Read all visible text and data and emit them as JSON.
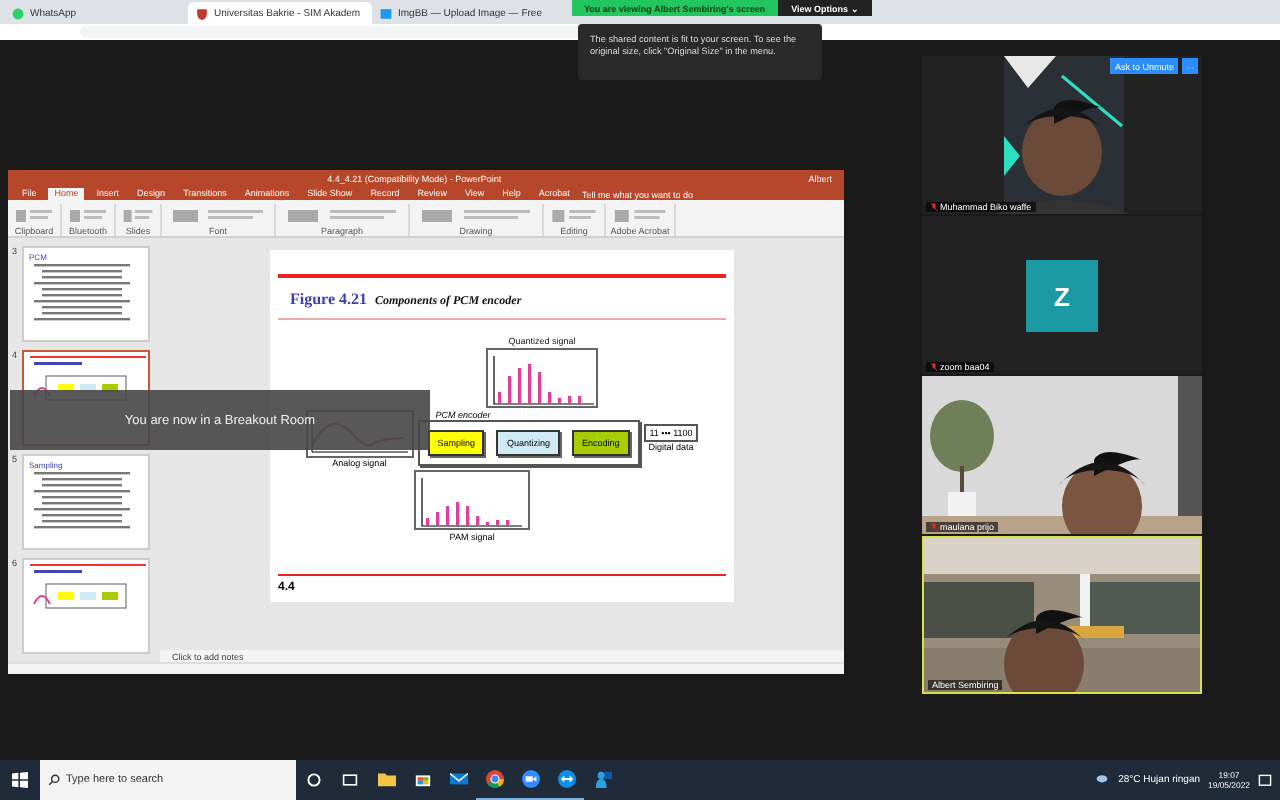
{
  "browser": {
    "tabs": [
      {
        "kind": "whatsapp",
        "label": "WhatsApp",
        "selected": false
      },
      {
        "kind": "campus",
        "label": "Universitas Bakrie - SIM Akadem",
        "selected": true
      },
      {
        "kind": "imgbb",
        "label": "ImgBB — Upload Image — Free",
        "selected": false
      }
    ]
  },
  "zoom": {
    "banner": "You are viewing Albert Sembiring's screen",
    "view_options": "View Options ⌄",
    "tooltip": "The shared content is fit to your screen. To see the original size, click \"Original Size\" in the menu.",
    "breakout_notice": "You are now in a Breakout Room",
    "ask_unmute": "Ask to Unmute",
    "more": "···",
    "participants": [
      {
        "kind": "video",
        "name": "Muhammad Biko waffe",
        "muted": true,
        "selected": false
      },
      {
        "kind": "avatar",
        "initial": "Z",
        "name": "zoom baa04",
        "muted": true,
        "selected": false
      },
      {
        "kind": "video",
        "name": "maulana prijo",
        "muted": true,
        "selected": false
      },
      {
        "kind": "video",
        "name": "Albert Sembiring",
        "muted": false,
        "selected": true
      }
    ]
  },
  "powerpoint": {
    "title": "4.4_4.21 (Compatibility Mode) - PowerPoint",
    "user": "Albert",
    "ribbon_tabs": [
      {
        "label": "File",
        "selected": false
      },
      {
        "label": "Home",
        "selected": true
      },
      {
        "label": "Insert",
        "selected": false
      },
      {
        "label": "Design",
        "selected": false
      },
      {
        "label": "Transitions",
        "selected": false
      },
      {
        "label": "Animations",
        "selected": false
      },
      {
        "label": "Slide Show",
        "selected": false
      },
      {
        "label": "Record",
        "selected": false
      },
      {
        "label": "Review",
        "selected": false
      },
      {
        "label": "View",
        "selected": false
      },
      {
        "label": "Help",
        "selected": false
      },
      {
        "label": "Acrobat",
        "selected": false
      }
    ],
    "tell_me": "Tell me what you want to do",
    "ribbon_groups": [
      "Clipboard",
      "Bluetooth",
      "Slides",
      "Font",
      "Paragraph",
      "Drawing",
      "Editing",
      "Adobe Acrobat"
    ],
    "thumbnails": [
      {
        "number": "3",
        "kind": "text",
        "title": "PCM",
        "selected": false
      },
      {
        "number": "4",
        "kind": "figure",
        "selected": true
      },
      {
        "number": "5",
        "kind": "text",
        "title": "Sampling",
        "selected": false
      },
      {
        "number": "6",
        "kind": "figure",
        "selected": false
      }
    ],
    "slide": {
      "figure_label": "Figure 4.21",
      "caption": "Components of PCM encoder",
      "quantized": "Quantized signal",
      "encoder": "PCM encoder",
      "blocks": [
        {
          "label": "Sampling",
          "color": "#ffff00"
        },
        {
          "label": "Quantizing",
          "color": "#cfeaf5"
        },
        {
          "label": "Encoding",
          "color": "#a8cc00"
        }
      ],
      "output": "11 ••• 1100",
      "analog": "Analog signal",
      "digital": "Digital data",
      "pam": "PAM signal",
      "page": "4.4"
    },
    "notes": "Click to add notes"
  },
  "taskbar": {
    "search": "Type here to search",
    "apps": [
      {
        "kind": "cortana",
        "open": false
      },
      {
        "kind": "taskview",
        "open": false
      },
      {
        "kind": "explorer",
        "open": false
      },
      {
        "kind": "store",
        "open": false
      },
      {
        "kind": "mail",
        "open": false
      },
      {
        "kind": "chrome",
        "open": true
      },
      {
        "kind": "zoom",
        "open": true
      },
      {
        "kind": "teamviewer",
        "open": true
      },
      {
        "kind": "people",
        "open": false
      }
    ],
    "weather": "28°C  Hujan ringan",
    "time": "19:07",
    "date": "19/05/2022"
  }
}
